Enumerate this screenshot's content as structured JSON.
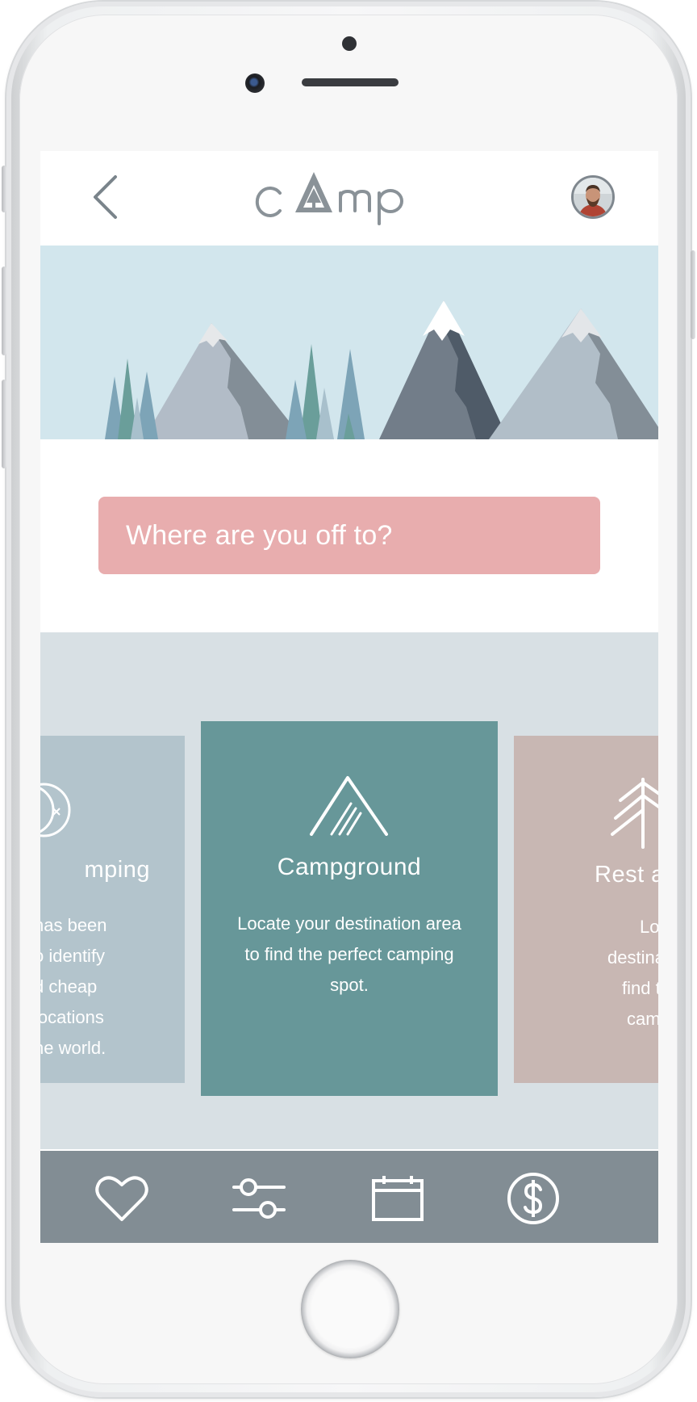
{
  "app": {
    "logo_text": "cAmp"
  },
  "header": {
    "back_icon": "chevron-left-icon",
    "avatar_icon": "user-avatar"
  },
  "search": {
    "placeholder": "Where are you off to?"
  },
  "cards": [
    {
      "title": "mping",
      "lines": [
        "has been",
        "o identify",
        "d cheap",
        "locations",
        "he world."
      ],
      "icon": "moon-icon"
    },
    {
      "title": "Campground",
      "text": "Locate your destination area to find the perfect camping spot.",
      "icon": "tent-icon"
    },
    {
      "title": "Rest a",
      "lines": [
        "Locate",
        "destinatio",
        "find the",
        "campin"
      ],
      "icon": "tree-icon"
    }
  ],
  "bottom_nav": [
    {
      "icon": "heart-icon"
    },
    {
      "icon": "sliders-icon"
    },
    {
      "icon": "calendar-icon"
    },
    {
      "icon": "dollar-icon"
    }
  ],
  "colors": {
    "accent_pink": "#e8adae",
    "teal_card": "#679799",
    "blue_card": "#b3c4cc",
    "rose_card": "#c8b7b3",
    "nav_bar": "#828d94",
    "sky": "#d2e6ed"
  }
}
